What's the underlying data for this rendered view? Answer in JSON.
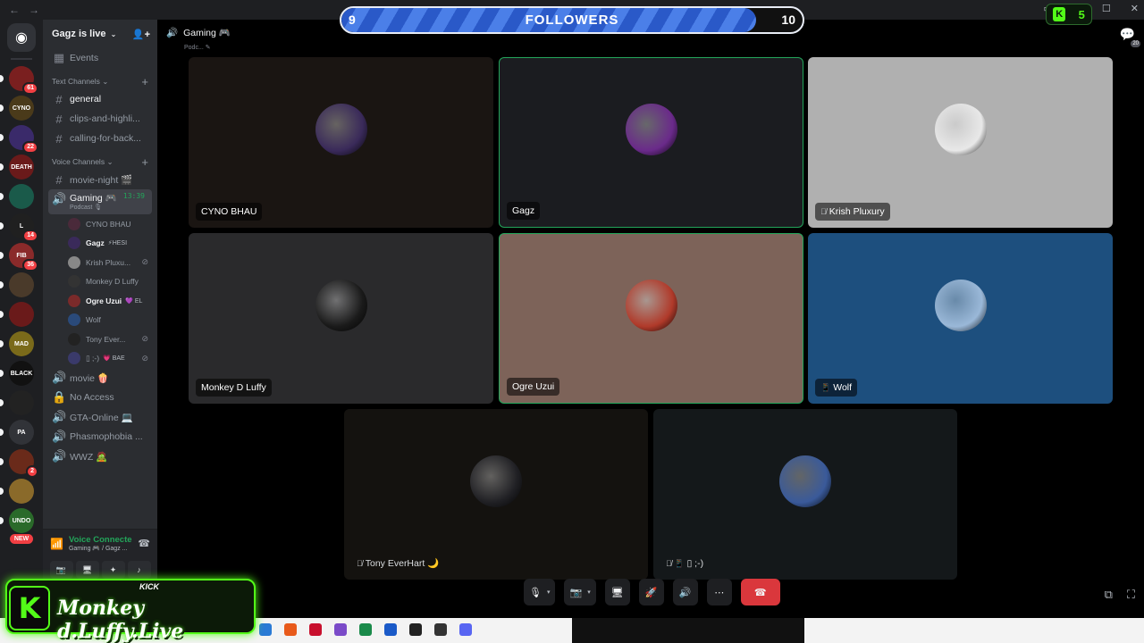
{
  "window": {
    "back": "←",
    "forward": "→"
  },
  "rail": {
    "home_label": "◉",
    "servers": [
      {
        "abbr": "",
        "color": "#7a1f1f",
        "badge": "61"
      },
      {
        "abbr": "CYNO",
        "color": "#4a3a1a",
        "badge": ""
      },
      {
        "abbr": "",
        "color": "#3a2a6a",
        "badge": "22"
      },
      {
        "abbr": "DEATH",
        "color": "#6a1a1a",
        "badge": ""
      },
      {
        "abbr": "",
        "color": "#1a5a4a",
        "badge": ""
      },
      {
        "abbr": "L",
        "color": "#202020",
        "badge": "14"
      },
      {
        "abbr": "FIB",
        "color": "#8a2a2a",
        "badge": "36"
      },
      {
        "abbr": "",
        "color": "#4a3a2a",
        "badge": ""
      },
      {
        "abbr": "",
        "color": "#6a1a1a",
        "badge": ""
      },
      {
        "abbr": "MAD",
        "color": "#7a6a1a",
        "badge": ""
      },
      {
        "abbr": "BLACK",
        "color": "#111111",
        "badge": ""
      },
      {
        "abbr": "",
        "color": "#222222",
        "badge": ""
      },
      {
        "abbr": "PA",
        "color": "#313338",
        "badge": ""
      },
      {
        "abbr": "",
        "color": "#6a2a1a",
        "badge": "2"
      },
      {
        "abbr": "",
        "color": "#8a6a2a",
        "badge": ""
      },
      {
        "abbr": "UNDO",
        "color": "#2a6a2a",
        "badge": ""
      }
    ],
    "new_label": "NEW"
  },
  "sidebar": {
    "guild_name": "Gagz is live",
    "events": "Events",
    "text_category": "Text Channels",
    "text_channels": [
      "general",
      "clips-and-highli...",
      "calling-for-back..."
    ],
    "voice_category": "Voice Channels",
    "voice_channels_top": [
      "movie-night 🎬"
    ],
    "active_channel": {
      "name": "Gaming 🎮",
      "sub": "Podcast 🎙",
      "timer": "13:39"
    },
    "members": [
      {
        "name": "CYNO BHAU",
        "tag": "",
        "color": "#4a2a3a",
        "bold": false,
        "muted": false
      },
      {
        "name": "Gagz",
        "tag": "⚡HESI",
        "color": "#3a2a5a",
        "bold": true,
        "muted": false
      },
      {
        "name": "Krish Pluxu...",
        "tag": "",
        "color": "#888888",
        "bold": false,
        "muted": true
      },
      {
        "name": "Monkey D Luffy",
        "tag": "",
        "color": "#333333",
        "bold": false,
        "muted": false
      },
      {
        "name": "Ogre Uzui",
        "tag": "💜 EL",
        "color": "#7a2a2a",
        "bold": true,
        "muted": false
      },
      {
        "name": "Wolf",
        "tag": "",
        "color": "#2a4a7a",
        "bold": false,
        "muted": false
      },
      {
        "name": "Tony Ever...",
        "tag": "",
        "color": "#222222",
        "bold": false,
        "muted": true
      },
      {
        "name": "▯ ;-)",
        "tag": "💗 BAE",
        "color": "#3a3a6a",
        "bold": false,
        "muted": true
      }
    ],
    "voice_channels_bottom": [
      {
        "icon": "🔊",
        "name": "movie 🍿"
      },
      {
        "icon": "🔒",
        "name": "No Access"
      },
      {
        "icon": "🔊",
        "name": "GTA-Online 💻"
      },
      {
        "icon": "🔊",
        "name": "Phasmophobia ..."
      },
      {
        "icon": "🔊",
        "name": "WWZ 🧟"
      }
    ],
    "voice_status": {
      "title": "Voice Connecte",
      "sub": "Gaming 🎮 / Gagz ..."
    }
  },
  "call": {
    "title": "Gaming 🎮",
    "subtitle": "Podc... ✎",
    "chat_count": "20",
    "tiles": [
      {
        "name": "CYNO BHAU",
        "icon": "",
        "bg": "#1a1512",
        "av": "#3a2a5a",
        "speaking": false
      },
      {
        "name": "Gagz",
        "icon": "",
        "bg": "#1b1c20",
        "av": "#6a2a8a",
        "speaking": true
      },
      {
        "name": "Krish Pluxury",
        "icon": "🎙̸",
        "bg": "#b0b0b0",
        "av": "#e8e8e8",
        "speaking": false
      },
      {
        "name": "Monkey D Luffy",
        "icon": "",
        "bg": "#2a2a2c",
        "av": "#1a1a1a",
        "speaking": false
      },
      {
        "name": "Ogre Uzui",
        "icon": "",
        "bg": "#7d6359",
        "av": "#b03a2a",
        "speaking": true
      },
      {
        "name": "Wolf",
        "icon": "📱",
        "bg": "#1d4f7e",
        "av": "#9ab8d8",
        "speaking": false
      },
      {
        "name": "Tony EverHart 🌙",
        "icon": "🎙̸",
        "bg": "#14120f",
        "av": "#202024",
        "speaking": false
      },
      {
        "name": "▯ ;-)",
        "icon": "🎙̸ 📱",
        "bg": "#14181a",
        "av": "#3a5a9a",
        "speaking": false
      }
    ],
    "controls": {
      "mic": "🎙",
      "camera": "📷",
      "share": "🖥",
      "activity": "🚀",
      "soundboard": "🔊",
      "more": "⋯",
      "disconnect": "☎"
    }
  },
  "overlay": {
    "followers_current": "9",
    "followers_goal": "10",
    "followers_label": "FOLLOWERS",
    "followers_progress": 0.9,
    "kick_badge_letter": "K",
    "kick_badge_count": "5",
    "brand_k": "K",
    "brand_kick": "KICK",
    "brand_name": "Monkey d.Luffy.Live"
  },
  "colors": {
    "accent": "#23a55a",
    "danger": "#da373c",
    "kick": "#53fc18"
  }
}
